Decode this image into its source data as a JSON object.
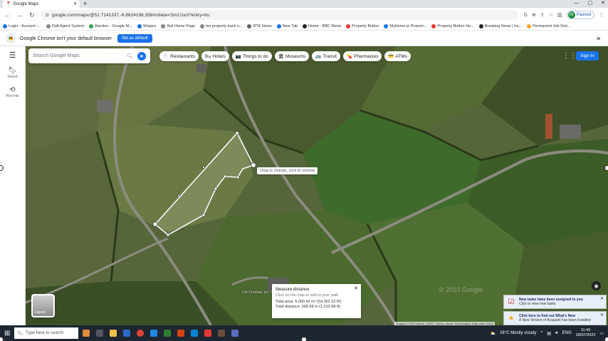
{
  "browser": {
    "tab_title": "Google Maps",
    "url": "google.com/maps/@51.7141337,-8.8624196,358m/data=!3m1!1e3?entry=ttu",
    "profile_label": "Paused",
    "profile_initial": "W",
    "bookmarks": [
      {
        "label": "Login - Account -...",
        "color": "#1a73e8"
      },
      {
        "label": "Daft Agent System",
        "color": "#888"
      },
      {
        "label": "Bandon - Google M...",
        "color": "#34a853"
      },
      {
        "label": "Shapes",
        "color": "#1a73e8"
      },
      {
        "label": "Ask Home Page",
        "color": "#888"
      },
      {
        "label": "lee property back o...",
        "color": "#888"
      },
      {
        "label": "RTE News",
        "color": "#666"
      },
      {
        "label": "New Tab",
        "color": "#1a73e8"
      },
      {
        "label": "Home - BBC News",
        "color": "#222"
      },
      {
        "label": "Property Button",
        "color": "#e53935"
      },
      {
        "label": "MyHome.ie Propert...",
        "color": "#1a73e8"
      },
      {
        "label": "Property Button Ho...",
        "color": "#e53935"
      },
      {
        "label": "Breaking News | Ira...",
        "color": "#222"
      },
      {
        "label": "Permanent Job Onli...",
        "color": "#f9a825"
      }
    ],
    "infobar_message": "Google Chrome isn't your default browser",
    "infobar_button": "Set as default"
  },
  "maps": {
    "search_placeholder": "Search Google Maps",
    "rail": {
      "saved": "Saved",
      "recents": "Recents"
    },
    "chips": [
      {
        "icon": "🍴",
        "label": "Restaurants"
      },
      {
        "icon": "🛏",
        "label": "Hotels"
      },
      {
        "icon": "📷",
        "label": "Things to do"
      },
      {
        "icon": "🏛",
        "label": "Museums"
      },
      {
        "icon": "🚌",
        "label": "Transit"
      },
      {
        "icon": "💊",
        "label": "Pharmacies"
      },
      {
        "icon": "💳",
        "label": "ATMs"
      }
    ],
    "sign_in": "Sign in",
    "tooltip": "Drag to change, click to remove",
    "measure": {
      "title": "Measure distance",
      "hint": "Click on the map to add to your path",
      "area": "Total area: 5,050.42 m² (54,362.32 ft²)",
      "distance": "Total distance: 368.99 m (1,210.58 ft)"
    },
    "layers_label": "Layers",
    "watermark": "© 2023 Google",
    "place_label": "Cill Choltais (or The Number Fi...)",
    "attribution": "Imagery ©2023 Airbus, CNES / Airbus, Maxar Technologies, Map data ©2023"
  },
  "notifications": [
    {
      "title": "New tasks have been assigned to you",
      "text": "Click to view new tasks"
    },
    {
      "title": "Click here to find out What's New",
      "text": "A New Version of Acquaint has been Installed"
    }
  ],
  "taskbar": {
    "search_placeholder": "Type here to search",
    "weather": "16°C Mostly cloudy",
    "language": "ENG",
    "time": "11:49",
    "date": "28/07/2023"
  }
}
